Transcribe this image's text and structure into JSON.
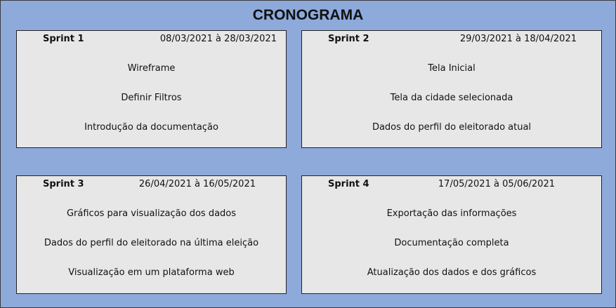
{
  "title": "CRONOGRAMA",
  "sprints": [
    {
      "name": "Sprint 1",
      "dates": "08/03/2021 à 28/03/2021",
      "items": [
        "Wireframe",
        "Definir Filtros",
        "Introdução da documentação"
      ]
    },
    {
      "name": "Sprint 2",
      "dates": "29/03/2021 à 18/04/2021",
      "items": [
        "Tela Inicial",
        "Tela da cidade selecionada",
        "Dados do perfil do eleitorado atual"
      ]
    },
    {
      "name": "Sprint 3",
      "dates": "26/04/2021 à 16/05/2021",
      "items": [
        "Gráficos para visualização dos dados",
        "Dados do perfil do eleitorado na última eleição",
        "Visualização em um plataforma web"
      ]
    },
    {
      "name": "Sprint 4",
      "dates": "17/05/2021 à 05/06/2021",
      "items": [
        "Exportação das informações",
        "Documentação completa",
        "Atualização dos dados e dos gráficos"
      ]
    }
  ]
}
